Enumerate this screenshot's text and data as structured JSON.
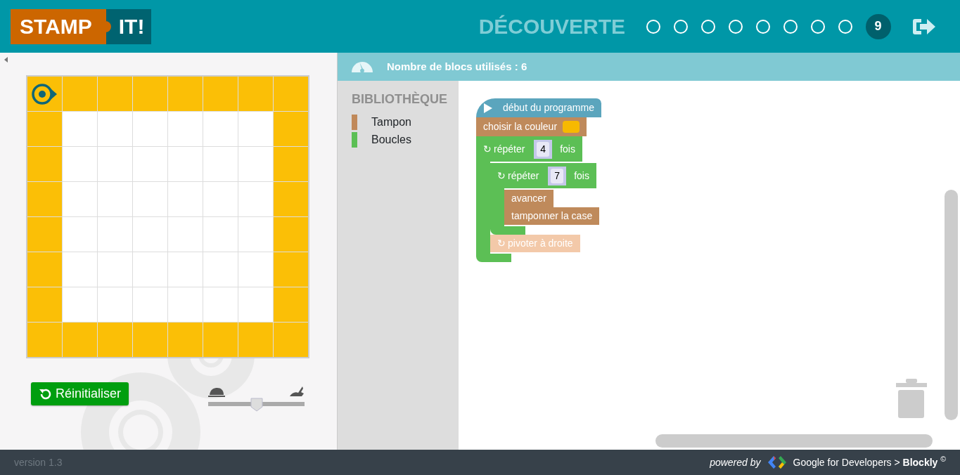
{
  "header": {
    "logo": {
      "part_1": "STAMP",
      "part_2": "IT!"
    },
    "title": "DÉCOUVERTE",
    "levels": [
      {
        "selected": false
      },
      {
        "selected": false
      },
      {
        "selected": false
      },
      {
        "selected": false
      },
      {
        "selected": false
      },
      {
        "selected": false
      },
      {
        "selected": false
      },
      {
        "selected": false
      },
      {
        "selected": true,
        "number": "9"
      }
    ]
  },
  "board": {
    "rows": [
      [
        {
          "stamped": true,
          "robot": true
        },
        {
          "stamped": true,
          "robot": false
        },
        {
          "stamped": true,
          "robot": false
        },
        {
          "stamped": true,
          "robot": false
        },
        {
          "stamped": true,
          "robot": false
        },
        {
          "stamped": true,
          "robot": false
        },
        {
          "stamped": true,
          "robot": false
        },
        {
          "stamped": true,
          "robot": false
        }
      ],
      [
        {
          "stamped": true,
          "robot": false
        },
        {
          "stamped": false,
          "robot": false
        },
        {
          "stamped": false,
          "robot": false
        },
        {
          "stamped": false,
          "robot": false
        },
        {
          "stamped": false,
          "robot": false
        },
        {
          "stamped": false,
          "robot": false
        },
        {
          "stamped": false,
          "robot": false
        },
        {
          "stamped": true,
          "robot": false
        }
      ],
      [
        {
          "stamped": true,
          "robot": false
        },
        {
          "stamped": false,
          "robot": false
        },
        {
          "stamped": false,
          "robot": false
        },
        {
          "stamped": false,
          "robot": false
        },
        {
          "stamped": false,
          "robot": false
        },
        {
          "stamped": false,
          "robot": false
        },
        {
          "stamped": false,
          "robot": false
        },
        {
          "stamped": true,
          "robot": false
        }
      ],
      [
        {
          "stamped": true,
          "robot": false
        },
        {
          "stamped": false,
          "robot": false
        },
        {
          "stamped": false,
          "robot": false
        },
        {
          "stamped": false,
          "robot": false
        },
        {
          "stamped": false,
          "robot": false
        },
        {
          "stamped": false,
          "robot": false
        },
        {
          "stamped": false,
          "robot": false
        },
        {
          "stamped": true,
          "robot": false
        }
      ],
      [
        {
          "stamped": true,
          "robot": false
        },
        {
          "stamped": false,
          "robot": false
        },
        {
          "stamped": false,
          "robot": false
        },
        {
          "stamped": false,
          "robot": false
        },
        {
          "stamped": false,
          "robot": false
        },
        {
          "stamped": false,
          "robot": false
        },
        {
          "stamped": false,
          "robot": false
        },
        {
          "stamped": true,
          "robot": false
        }
      ],
      [
        {
          "stamped": true,
          "robot": false
        },
        {
          "stamped": false,
          "robot": false
        },
        {
          "stamped": false,
          "robot": false
        },
        {
          "stamped": false,
          "robot": false
        },
        {
          "stamped": false,
          "robot": false
        },
        {
          "stamped": false,
          "robot": false
        },
        {
          "stamped": false,
          "robot": false
        },
        {
          "stamped": true,
          "robot": false
        }
      ],
      [
        {
          "stamped": true,
          "robot": false
        },
        {
          "stamped": false,
          "robot": false
        },
        {
          "stamped": false,
          "robot": false
        },
        {
          "stamped": false,
          "robot": false
        },
        {
          "stamped": false,
          "robot": false
        },
        {
          "stamped": false,
          "robot": false
        },
        {
          "stamped": false,
          "robot": false
        },
        {
          "stamped": true,
          "robot": false
        }
      ],
      [
        {
          "stamped": true,
          "robot": false
        },
        {
          "stamped": true,
          "robot": false
        },
        {
          "stamped": true,
          "robot": false
        },
        {
          "stamped": true,
          "robot": false
        },
        {
          "stamped": true,
          "robot": false
        },
        {
          "stamped": true,
          "robot": false
        },
        {
          "stamped": true,
          "robot": false
        },
        {
          "stamped": true,
          "robot": false
        }
      ]
    ]
  },
  "controls": {
    "reset_button": "Réinitialiser",
    "speed": {
      "level": 0.5
    }
  },
  "stats": {
    "label": "Nombre de blocs utilisés : 6"
  },
  "library": {
    "title": "BIBLIOTHÈQUE",
    "categories": [
      {
        "label": "Tampon",
        "color": "#c0895a"
      },
      {
        "label": "Boucles",
        "color": "#5cbf55"
      }
    ]
  },
  "program": [
    {
      "kind": "start",
      "text": "début du programme"
    },
    {
      "kind": "color",
      "text": "choisir la couleur",
      "color": "#f7b900"
    },
    {
      "kind": "repeat",
      "icon": "↻",
      "text": "répéter",
      "count": "4",
      "suffix": "fois",
      "children": [
        {
          "kind": "repeat",
          "icon": "↻",
          "text": "répéter",
          "count": "7",
          "suffix": "fois",
          "children": [
            {
              "kind": "action",
              "text": "avancer",
              "disabled": false
            },
            {
              "kind": "action",
              "text": "tamponner la case",
              "disabled": false
            }
          ]
        },
        {
          "kind": "action",
          "icon": "↻",
          "text": "pivoter à droite",
          "disabled": true
        }
      ]
    }
  ],
  "footer": {
    "version": "version 1.3",
    "powered_by": "powered by",
    "credit": "Google for Developers > **Blockly** $^{©}$"
  }
}
